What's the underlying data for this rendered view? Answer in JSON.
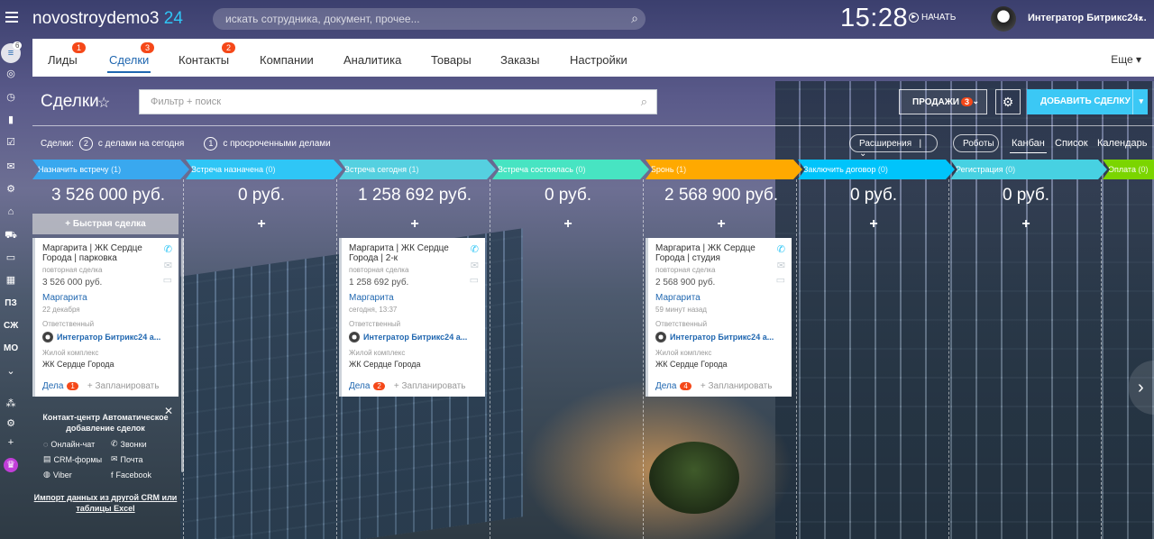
{
  "header": {
    "logo_main": "novostroydemo3",
    "logo_accent": "24",
    "search_placeholder": "искать сотрудника, документ, прочее...",
    "clock": "15:28",
    "start_label": "НАЧАТЬ",
    "user_name": "Интегратор Битрикс24..."
  },
  "rail": {
    "badge": "6",
    "texts": [
      "ПЗ",
      "СЖ",
      "МО"
    ]
  },
  "nav": {
    "tabs": [
      {
        "label": "Лиды",
        "badge": "1"
      },
      {
        "label": "Сделки",
        "badge": "3",
        "active": true
      },
      {
        "label": "Контакты",
        "badge": "2"
      },
      {
        "label": "Компании"
      },
      {
        "label": "Аналитика"
      },
      {
        "label": "Товары"
      },
      {
        "label": "Заказы"
      },
      {
        "label": "Настройки"
      }
    ],
    "more_label": "Еще"
  },
  "toolbar": {
    "title": "Сделки",
    "filter_placeholder": "Фильтр + поиск",
    "sales_label": "ПРОДАЖИ",
    "sales_badge": "3",
    "add_label": "ДОБАВИТЬ СДЕЛКУ"
  },
  "counters": {
    "prefix": "Сделки:",
    "today_count": "2",
    "today_label": "с делами на сегодня",
    "overdue_count": "1",
    "overdue_label": "с просроченными делами"
  },
  "views": {
    "extensions": "Расширения",
    "robots": "Роботы",
    "kanban": "Канбан",
    "list": "Список",
    "calendar": "Календарь"
  },
  "colors": {
    "accent": "#2fc6f6",
    "link": "#2067b0",
    "badge": "#f54819"
  },
  "quick_deal": "Быстрая сделка",
  "stages": [
    {
      "name": "Назначить встречу",
      "count": "(1)",
      "sum": "3 526 000 руб.",
      "color": "#39a8ef"
    },
    {
      "name": "Встреча назначена",
      "count": "(0)",
      "sum": "0 руб.",
      "color": "#2fc6f6"
    },
    {
      "name": "Встреча сегодня",
      "count": "(1)",
      "sum": "1 258 692 руб.",
      "color": "#55d0e0"
    },
    {
      "name": "Встреча состоялась",
      "count": "(0)",
      "sum": "0 руб.",
      "color": "#47e4c2"
    },
    {
      "name": "Бронь",
      "count": "(1)",
      "sum": "2 568 900 руб.",
      "color": "#ffa900"
    },
    {
      "name": "Заключить договор",
      "count": "(0)",
      "sum": "0 руб.",
      "color": "#00c4fb"
    },
    {
      "name": "Регистрация",
      "count": "(0)",
      "sum": "0 руб.",
      "color": "#47d1e2"
    },
    {
      "name": "Оплата",
      "count": "(0)",
      "sum": "",
      "color": "#7bd500"
    }
  ],
  "cards": [
    {
      "title": "Маргарита | ЖК Сердце Города | парковка",
      "sub": "повторная сделка",
      "amount": "3 526 000 руб.",
      "contact": "Маргарита",
      "date": "22 декабря",
      "resp_label": "Ответственный",
      "resp": "Интегратор Битрикс24 а...",
      "complex_label": "Жилой комплекс",
      "complex": "ЖК Сердце Города",
      "deals_label": "Дела",
      "deals_count": "1",
      "plan": "+ Запланировать"
    },
    {
      "title": "Маргарита | ЖК Сердце Города | 2-к",
      "sub": "повторная сделка",
      "amount": "1 258 692 руб.",
      "contact": "Маргарита",
      "date": "сегодня, 13:37",
      "resp_label": "Ответственный",
      "resp": "Интегратор Битрикс24 а...",
      "complex_label": "Жилой комплекс",
      "complex": "ЖК Сердце Города",
      "deals_label": "Дела",
      "deals_count": "2",
      "plan": "+ Запланировать"
    },
    {
      "title": "Маргарита | ЖК Сердце Города | студия",
      "sub": "повторная сделка",
      "amount": "2 568 900 руб.",
      "contact": "Маргарита",
      "date": "59 минут назад",
      "resp_label": "Ответственный",
      "resp": "Интегратор Битрикс24 а...",
      "complex_label": "Жилой комплекс",
      "complex": "ЖК Сердце Города",
      "deals_label": "Дела",
      "deals_count": "4",
      "plan": "+ Запланировать"
    }
  ],
  "widget": {
    "title": "Контакт-центр Автоматическое добавление сделок",
    "items": [
      "Онлайн-чат",
      "Звонки",
      "CRM-формы",
      "Почта",
      "Viber",
      "Facebook"
    ],
    "import": "Импорт данных из другой CRM или таблицы Excel"
  }
}
